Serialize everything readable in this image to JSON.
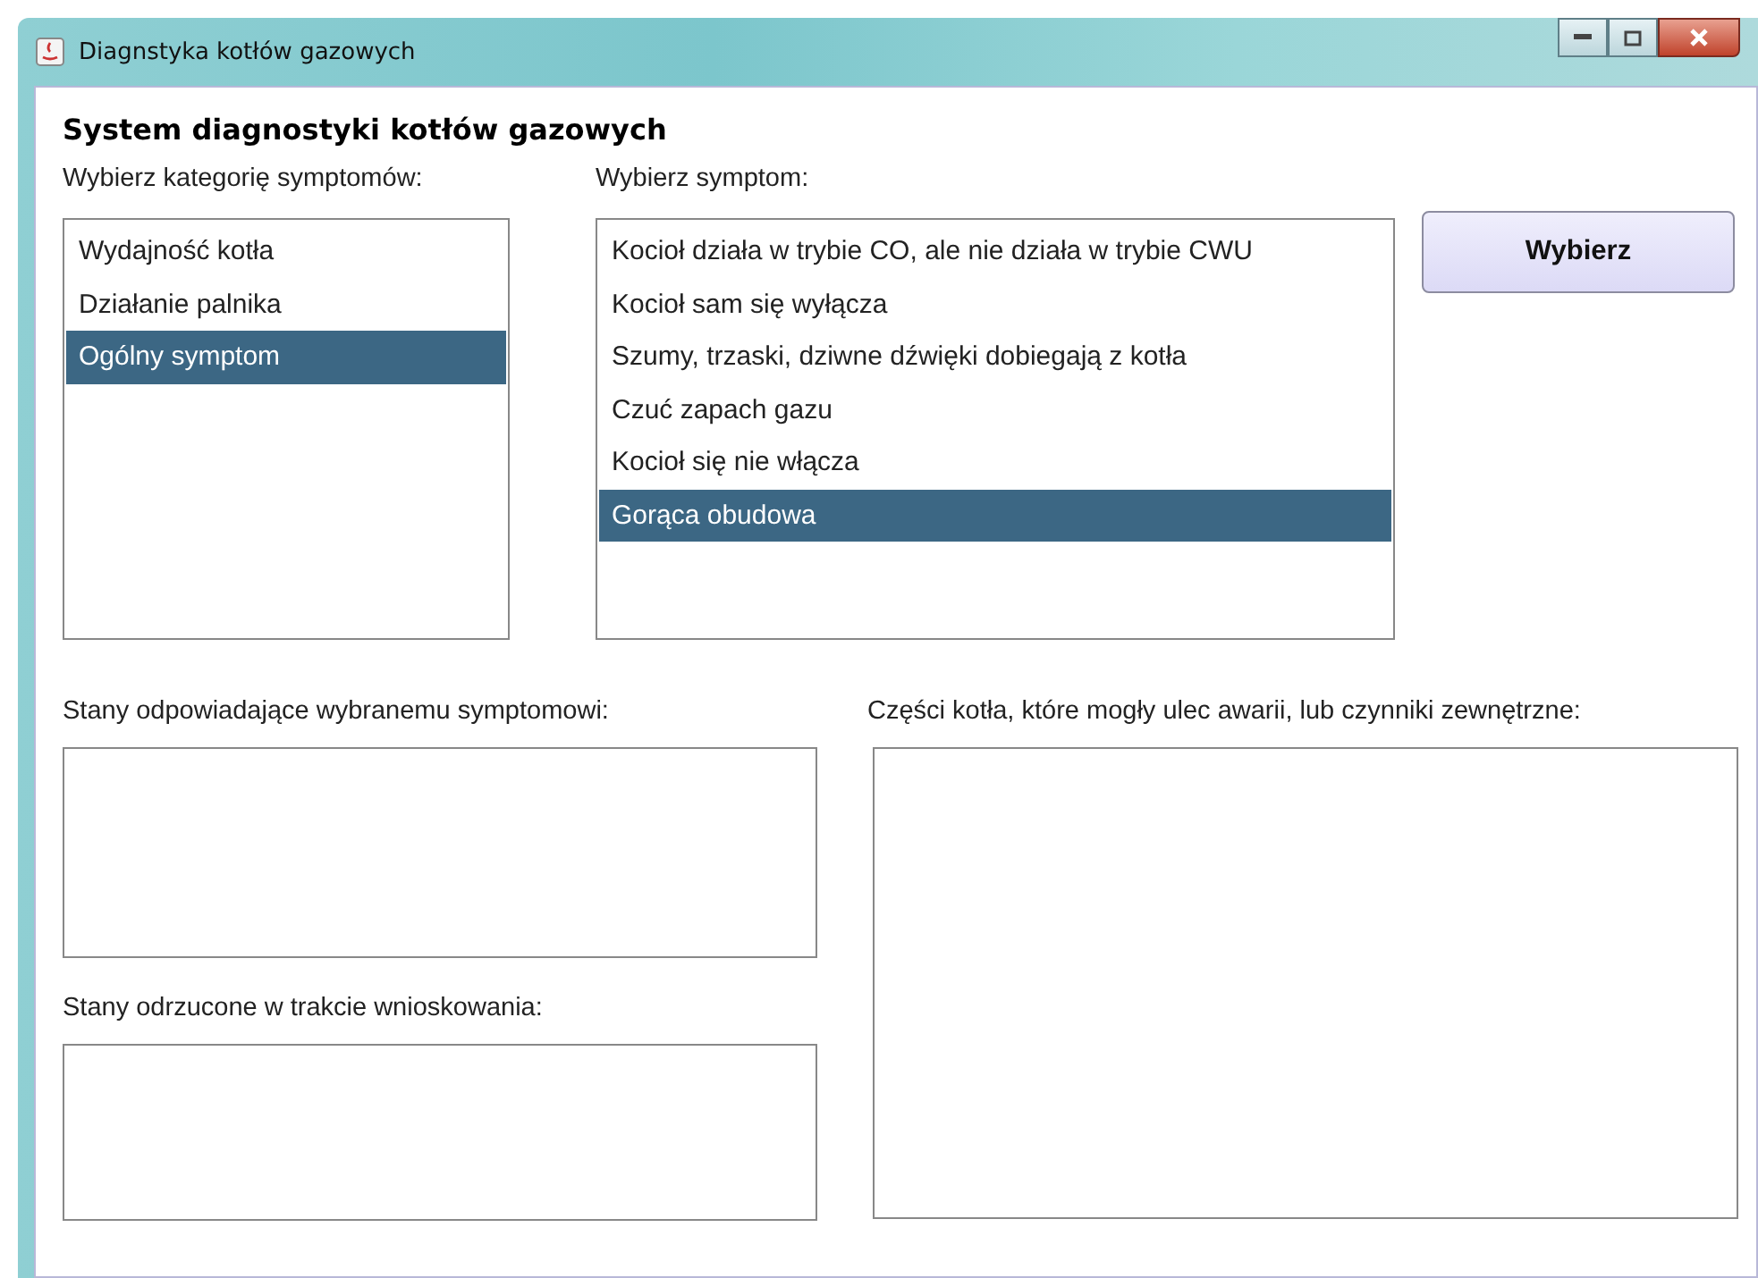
{
  "window": {
    "title": "Diagnstyka kotłów gazowych"
  },
  "heading": "System diagnostyki kotłów gazowych",
  "categories": {
    "label": "Wybierz kategorię symptomów:",
    "items": [
      {
        "text": "Wydajność kotła",
        "selected": false
      },
      {
        "text": "Działanie palnika",
        "selected": false
      },
      {
        "text": "Ogólny symptom",
        "selected": true
      }
    ]
  },
  "symptoms": {
    "label": "Wybierz symptom:",
    "items": [
      {
        "text": "Kocioł działa w trybie CO, ale nie działa w trybie CWU",
        "selected": false
      },
      {
        "text": "Kocioł sam się wyłącza",
        "selected": false
      },
      {
        "text": "Szumy, trzaski, dziwne dźwięki dobiegają z kotła",
        "selected": false
      },
      {
        "text": "Czuć zapach gazu",
        "selected": false
      },
      {
        "text": "Kocioł się nie włącza",
        "selected": false
      },
      {
        "text": "Gorąca obudowa",
        "selected": true
      }
    ]
  },
  "select_button": "Wybierz",
  "matching_states": {
    "label": "Stany odpowiadające wybranemu symptomowi:"
  },
  "rejected_states": {
    "label": "Stany odrzucone w trakcie wnioskowania:"
  },
  "failed_parts": {
    "label": "Części kotła, które mogły ulec awarii, lub czynniki zewnętrzne:"
  }
}
